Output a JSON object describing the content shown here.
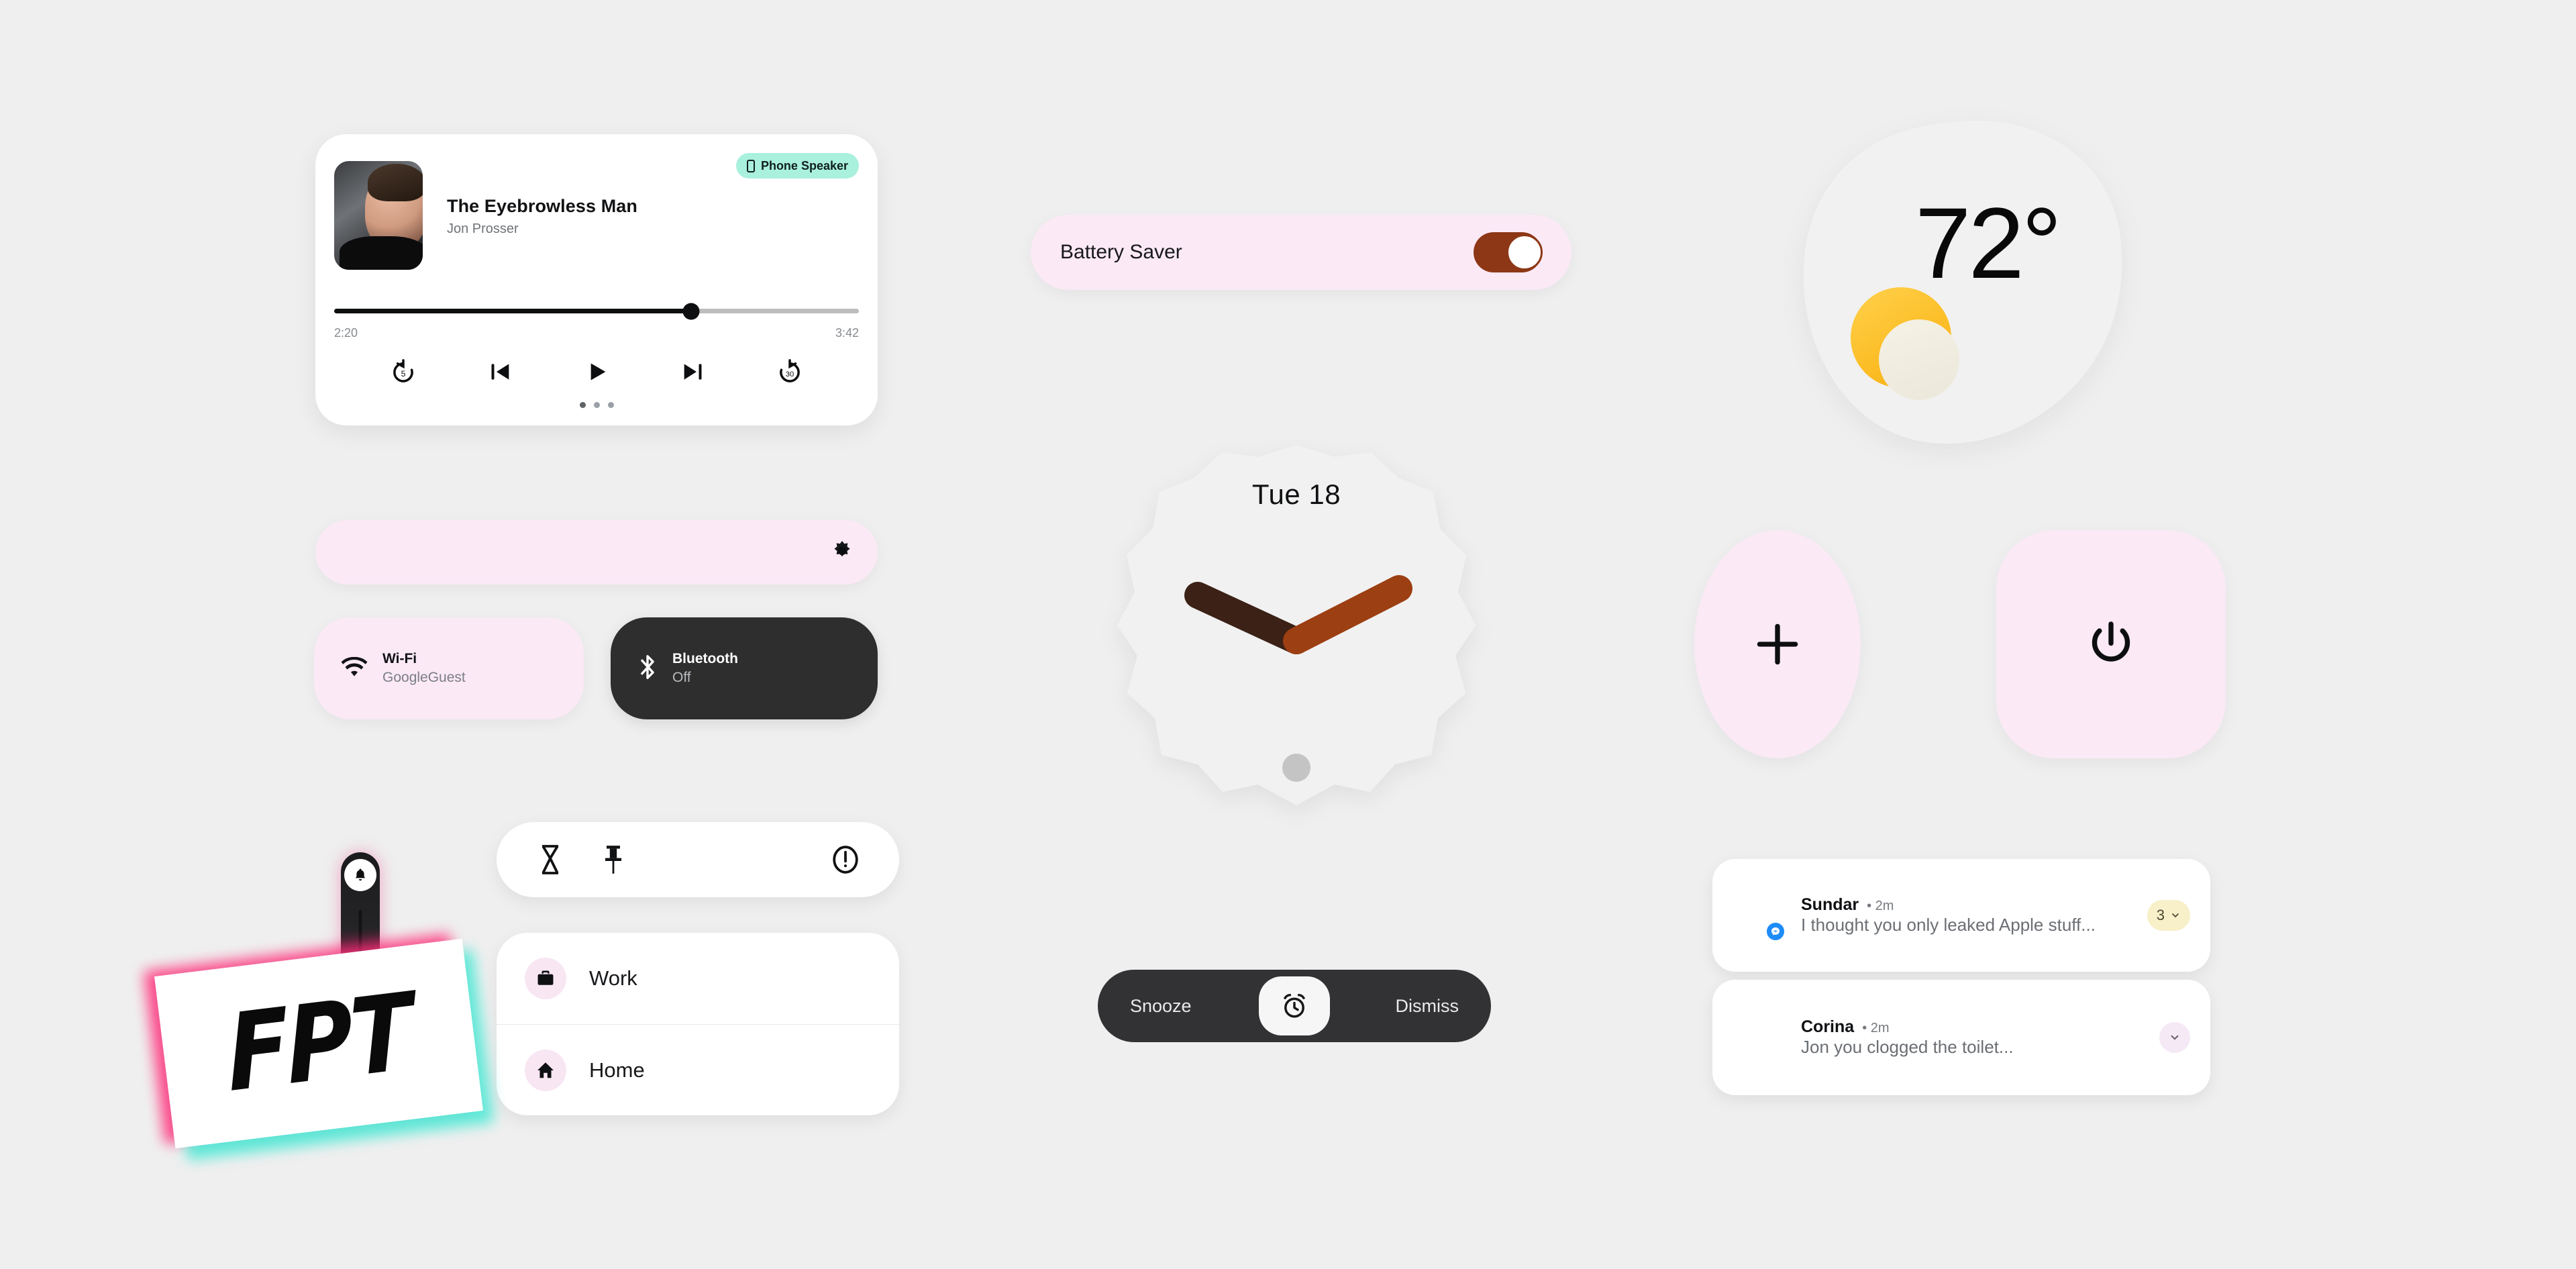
{
  "media_player": {
    "track_title": "The Eyebrowless Man",
    "artist": "Jon Prosser",
    "output_chip": "Phone Speaker",
    "output_icon": "phone-icon",
    "time_current": "2:20",
    "time_total": "3:42",
    "progress_percent": 68,
    "controls": [
      {
        "name": "replay-5-icon",
        "label": "5"
      },
      {
        "name": "skip-previous-icon",
        "label": ""
      },
      {
        "name": "play-icon",
        "label": ""
      },
      {
        "name": "skip-next-icon",
        "label": ""
      },
      {
        "name": "forward-30-icon",
        "label": "30"
      }
    ],
    "page_dots": 3
  },
  "brightness": {
    "icon": "brightness-icon"
  },
  "tiles": {
    "wifi": {
      "title": "Wi-Fi",
      "subtitle": "GoogleGuest",
      "icon": "wifi-icon",
      "bg": "#fbe9f6"
    },
    "bluetooth": {
      "title": "Bluetooth",
      "subtitle": "Off",
      "icon": "bluetooth-icon",
      "bg": "#2e2e2e"
    }
  },
  "icon_pill": {
    "items": [
      {
        "name": "hourglass-icon"
      },
      {
        "name": "pushpin-icon"
      },
      {
        "name": "alert-circle-icon"
      }
    ]
  },
  "places": {
    "items": [
      {
        "label": "Work",
        "icon": "briefcase-icon"
      },
      {
        "label": "Home",
        "icon": "home-icon"
      }
    ]
  },
  "alarm_handle": {
    "icon": "bell-icon"
  },
  "fpt_logo": {
    "wordmark": "FPT",
    "glow_pink": "#ff2d78",
    "glow_cyan": "#46e8d4"
  },
  "battery_saver": {
    "label": "Battery Saver",
    "toggle_on": true,
    "toggle_color": "#8d3716"
  },
  "clock": {
    "date": "Tue 18",
    "hand_color_hour": "#3b2116",
    "hand_color_minute": "#9c3f12",
    "hour_angle_deg": 305,
    "minute_angle_deg": 70
  },
  "alarm_bar": {
    "snooze_label": "Snooze",
    "dismiss_label": "Dismiss",
    "center_icon": "alarm-clock-icon"
  },
  "weather": {
    "temperature": "72°",
    "icon": "sun-behind-cloud-icon",
    "sun_color": "#fcbe27",
    "cloud_color": "#efebde"
  },
  "quick_buttons": {
    "add": {
      "icon": "plus-icon"
    },
    "power": {
      "icon": "power-icon"
    }
  },
  "notifications": {
    "items": [
      {
        "sender": "Sundar",
        "time": "• 2m",
        "message": "I thought you only leaked Apple stuff...",
        "count_badge": "3",
        "app_icon": "messenger-icon",
        "avatar": "sundar-avatar"
      },
      {
        "sender": "Corina",
        "time": "• 2m",
        "message": "Jon you clogged the toilet...",
        "count_badge": "",
        "app_icon": "",
        "avatar": "corina-avatar"
      }
    ]
  },
  "theme": {
    "background": "#efefef",
    "accent_pink": "#fbe9f6",
    "accent_mint": "#a9f0dd"
  }
}
